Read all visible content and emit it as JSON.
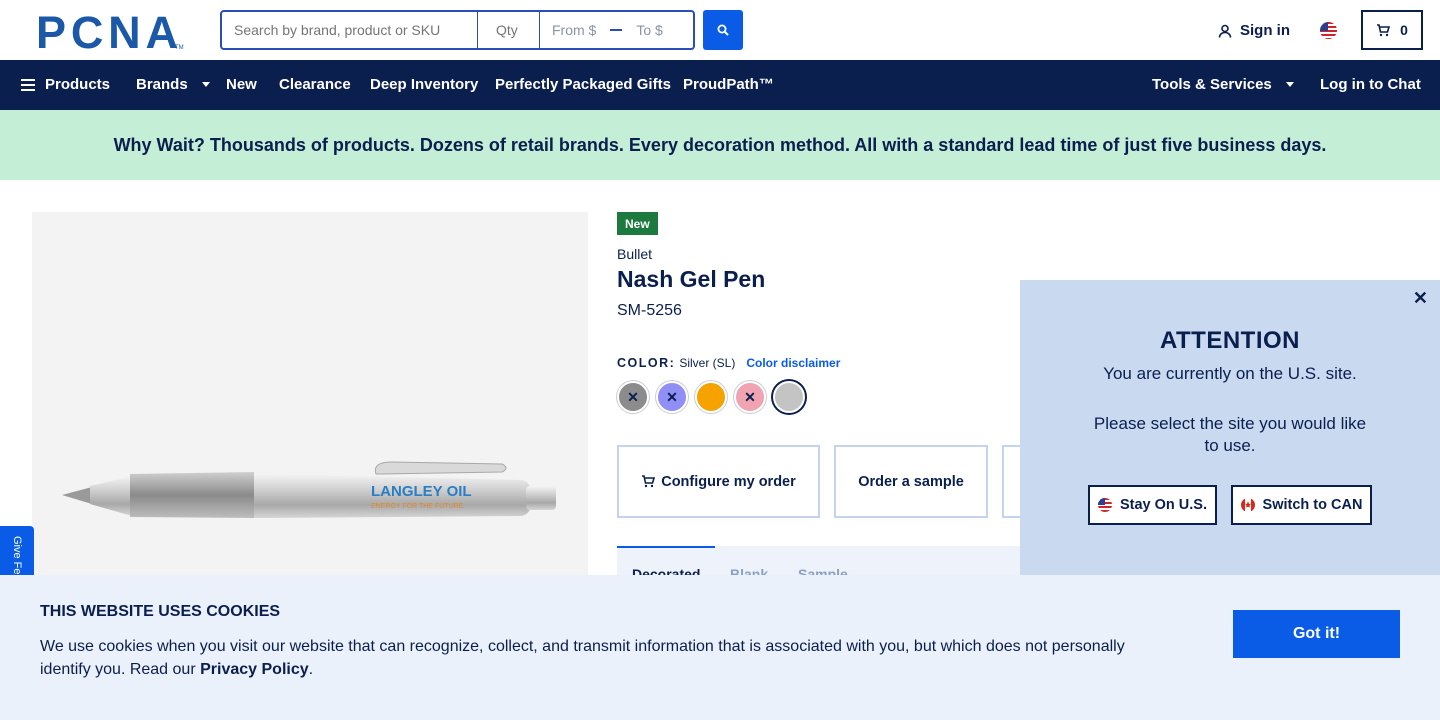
{
  "header": {
    "logo_text": "PCNA",
    "search": {
      "placeholder": "Search by brand, product or SKU"
    },
    "qty": {
      "placeholder": "Qty"
    },
    "price_range": {
      "from_placeholder": "From $",
      "to_placeholder": "To $"
    },
    "sign_in_label": "Sign in",
    "cart_count": "0"
  },
  "nav": {
    "items": [
      {
        "label": "Products"
      },
      {
        "label": "Brands"
      },
      {
        "label": "New"
      },
      {
        "label": "Clearance"
      },
      {
        "label": "Deep Inventory"
      },
      {
        "label": "Perfectly Packaged Gifts"
      },
      {
        "label": "ProudPath™"
      }
    ],
    "right": [
      {
        "label": "Tools & Services"
      },
      {
        "label": "Log in to Chat"
      }
    ]
  },
  "banner": {
    "text": "Why Wait? Thousands of products. Dozens of retail brands. Every decoration method. All with a standard lead time of just five business days."
  },
  "product": {
    "badge": "New",
    "brand": "Bullet",
    "name": "Nash Gel Pen",
    "sku": "SM-5256",
    "imprint_line1": "LANGLEY OIL",
    "imprint_line2": "ENERGY FOR THE FUTURE",
    "color_label": "COLOR:",
    "color_value": "Silver (SL)",
    "color_disclaimer": "Color disclaimer",
    "swatches": [
      {
        "name": "gray",
        "color": "#8c8c8c",
        "unavailable": true
      },
      {
        "name": "periwinkle",
        "color": "#8f8ff5",
        "unavailable": true
      },
      {
        "name": "orange",
        "color": "#f6a300",
        "unavailable": false
      },
      {
        "name": "pink",
        "color": "#f0a3b1",
        "unavailable": true
      },
      {
        "name": "silver",
        "color": "#c4c4c4",
        "unavailable": false,
        "selected": true
      }
    ],
    "actions": {
      "configure": "Configure my order",
      "sample": "Order a sample"
    },
    "tabs": [
      "Decorated",
      "Blank",
      "Sample"
    ]
  },
  "feedback_label": "Give Feedback",
  "attention": {
    "title": "ATTENTION",
    "line1": "You are currently on the U.S. site.",
    "line2": "Please select the site you would like to use.",
    "stay_label": "Stay On U.S.",
    "switch_label": "Switch to CAN"
  },
  "cookie": {
    "title": "THIS WEBSITE USES COOKIES",
    "text": "We use cookies when you visit our website that can recognize, collect, and transmit information that is associated with you, but which does not personally identify you. Read our",
    "link": "Privacy Policy",
    "period": ".",
    "button": "Got it!"
  },
  "colors": {
    "navy": "#0b1f4f",
    "blue": "#0a5ce6",
    "banner_green": "#c5eed6",
    "new_badge": "#1d7a3f"
  }
}
